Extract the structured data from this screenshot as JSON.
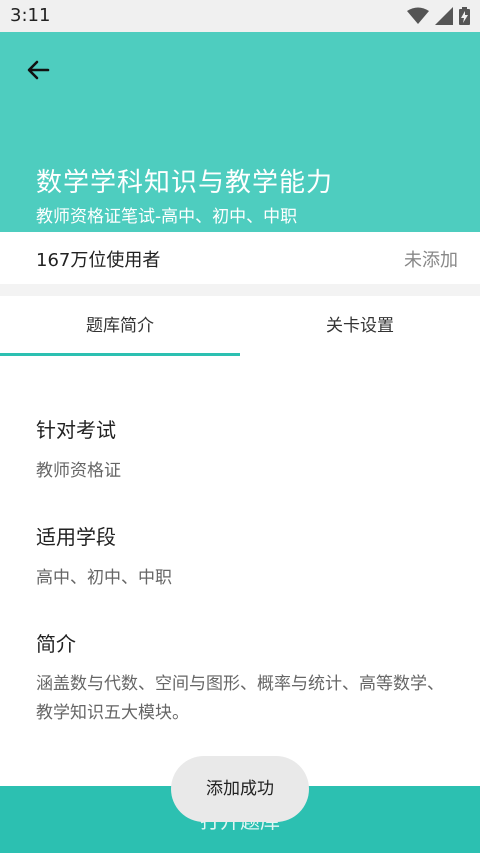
{
  "status_bar": {
    "time": "3:11",
    "icons": [
      "wifi-icon",
      "signal-icon",
      "battery-charging-icon"
    ]
  },
  "header": {
    "title": "数学学科知识与教学能力",
    "subtitle": "教师资格证笔试-高中、初中、中职",
    "background_color": "#4ecdbf"
  },
  "stats": {
    "users": "167万位使用者",
    "add_status": "未添加"
  },
  "tabs": [
    {
      "label": "题库简介",
      "selected": true
    },
    {
      "label": "关卡设置",
      "selected": false
    }
  ],
  "sections": [
    {
      "title": "针对考试",
      "value": "教师资格证"
    },
    {
      "title": "适用学段",
      "value": "高中、初中、中职"
    },
    {
      "title": "简介",
      "value": "涵盖数与代数、空间与图形、概率与统计、高等数学、教学知识五大模块。"
    }
  ],
  "bottom_button": {
    "label": "打开题库",
    "color": "#2cc0b1"
  },
  "toast": {
    "text": "添加成功"
  }
}
